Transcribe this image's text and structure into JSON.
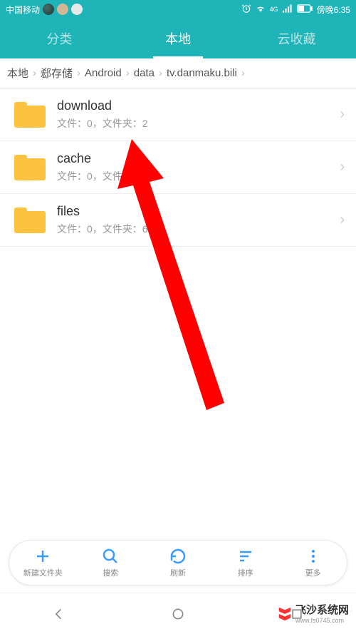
{
  "status": {
    "carrier": "中国移动",
    "time": "傍晚6:35",
    "network": "4G"
  },
  "tabs": [
    {
      "label": "分类",
      "active": false
    },
    {
      "label": "本地",
      "active": true
    },
    {
      "label": "云收藏",
      "active": false
    }
  ],
  "breadcrumb": [
    "本地",
    "郄存储",
    "Android",
    "data",
    "tv.danmaku.bili"
  ],
  "files": [
    {
      "name": "download",
      "meta": "文件：0，文件夹：2"
    },
    {
      "name": "cache",
      "meta": "文件：0，文件夹：4"
    },
    {
      "name": "files",
      "meta": "文件：0，文件夹：6"
    }
  ],
  "toolbar": [
    {
      "label": "新建文件夹",
      "icon": "plus"
    },
    {
      "label": "搜索",
      "icon": "search"
    },
    {
      "label": "刷新",
      "icon": "refresh"
    },
    {
      "label": "排序",
      "icon": "sort"
    },
    {
      "label": "更多",
      "icon": "more"
    }
  ],
  "watermark": "飞沙系统网",
  "watermark_url": "www.fs0745.com",
  "colors": {
    "primary": "#1fb5b8",
    "accent_blue": "#3b9cff",
    "folder": "#fdc23e",
    "arrow": "#ff0000"
  }
}
